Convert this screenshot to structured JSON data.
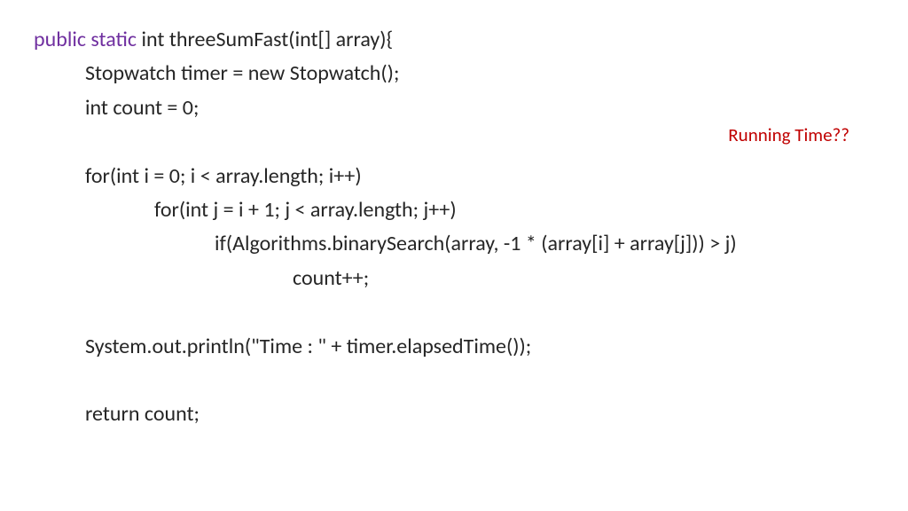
{
  "code": {
    "keyword": "public static ",
    "signature": "int threeSumFast(int[] array){",
    "line2": "Stopwatch timer = new Stopwatch();",
    "line3": "int count = 0;",
    "line4": "for(int i = 0; i < array.length; i++)",
    "line5": "for(int j = i + 1; j < array.length; j++)",
    "line6": "if(Algorithms.binarySearch(array, -1 * (array[i] + array[j])) > j)",
    "line7": "count++;",
    "line8": "System.out.println(\"Time : \" + timer.elapsedTime());",
    "line9": "return count;"
  },
  "annotation": "Running Time??"
}
